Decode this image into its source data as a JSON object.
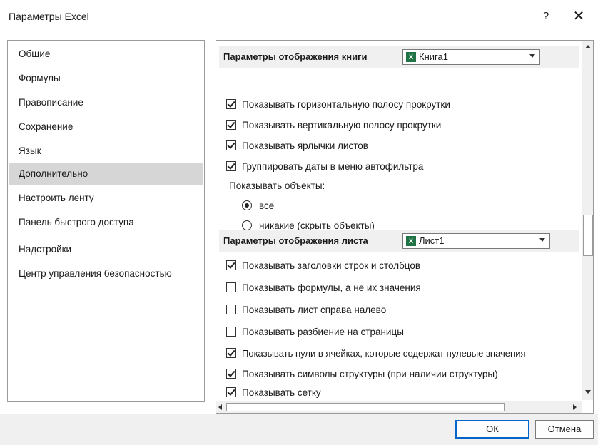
{
  "window": {
    "title": "Параметры Excel",
    "help_glyph": "?",
    "close_glyph": "✕"
  },
  "nav": {
    "items": [
      {
        "label": "Общие"
      },
      {
        "label": "Формулы"
      },
      {
        "label": "Правописание"
      },
      {
        "label": "Сохранение"
      },
      {
        "label": "Язык"
      },
      {
        "label": "Дополнительно",
        "selected": true
      },
      {
        "label": "Настроить ленту"
      },
      {
        "label": "Панель быстрого доступа"
      },
      {
        "label": "Надстройки"
      },
      {
        "label": "Центр управления безопасностью"
      }
    ]
  },
  "book_section": {
    "title": "Параметры отображения книги",
    "combo_value": "Книга1",
    "options": [
      {
        "label": "Показывать горизонтальную полосу прокрутки",
        "checked": true
      },
      {
        "label": "Показывать вертикальную полосу прокрутки",
        "checked": true
      },
      {
        "label": "Показывать ярлычки листов",
        "checked": true
      },
      {
        "label": "Группировать даты в меню автофильтра",
        "checked": true
      }
    ],
    "objects_label": "Показывать объекты:",
    "radios": [
      {
        "label": "все",
        "selected": true
      },
      {
        "label": "никакие (скрыть объекты)",
        "selected": false
      }
    ]
  },
  "sheet_section": {
    "title": "Параметры отображения листа",
    "combo_value": "Лист1",
    "options": [
      {
        "label": "Показывать заголовки строк и столбцов",
        "checked": true
      },
      {
        "label": "Показывать формулы, а не их значения",
        "checked": false
      },
      {
        "label": "Показывать лист справа налево",
        "checked": false
      },
      {
        "label": "Показывать разбиение на страницы",
        "checked": false
      },
      {
        "label": "Показывать нули в ячейках, которые содержат нулевые значения",
        "checked": true
      },
      {
        "label": "Показывать символы структуры (при наличии структуры)",
        "checked": true
      },
      {
        "label": "Показывать сетку",
        "checked": true
      }
    ]
  },
  "footer": {
    "ok_label": "ОК",
    "cancel_label": "Отмена"
  },
  "colors": {
    "excel_green": "#217346",
    "ok_border": "#0066cc"
  }
}
